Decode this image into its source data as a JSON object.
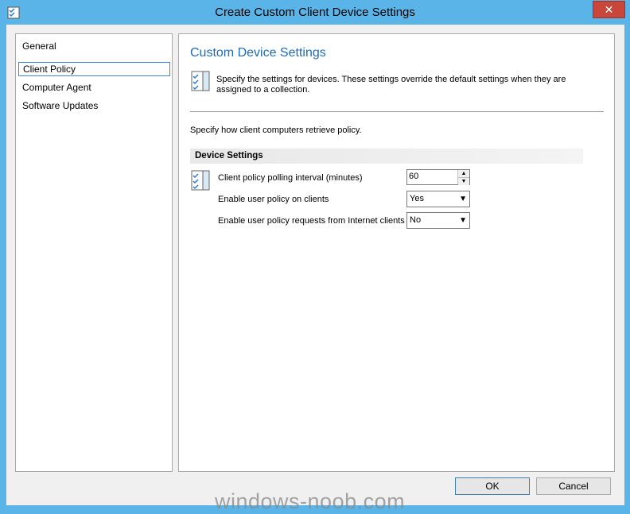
{
  "window": {
    "title": "Create Custom Client Device Settings",
    "close_label": "✕"
  },
  "nav": {
    "items": [
      {
        "label": "General",
        "selected": false
      },
      {
        "label": "Client Policy",
        "selected": true
      },
      {
        "label": "Computer Agent",
        "selected": false
      },
      {
        "label": "Software Updates",
        "selected": false
      }
    ]
  },
  "main": {
    "title": "Custom Device Settings",
    "description": "Specify the settings for devices. These settings override the default settings when they are assigned to a collection.",
    "instruction": "Specify how client computers retrieve policy.",
    "group_title": "Device Settings",
    "settings": [
      {
        "label": "Client policy polling interval (minutes)",
        "value": "60",
        "control": "spinner"
      },
      {
        "label": "Enable user policy on clients",
        "value": "Yes",
        "control": "dropdown"
      },
      {
        "label": "Enable user policy requests from Internet clients",
        "value": "No",
        "control": "dropdown"
      }
    ]
  },
  "buttons": {
    "ok": "OK",
    "cancel": "Cancel"
  },
  "watermark": "windows-noob.com",
  "colors": {
    "titlebar": "#5ab4e8",
    "accent": "#1e6bb8",
    "close": "#c8463a"
  }
}
